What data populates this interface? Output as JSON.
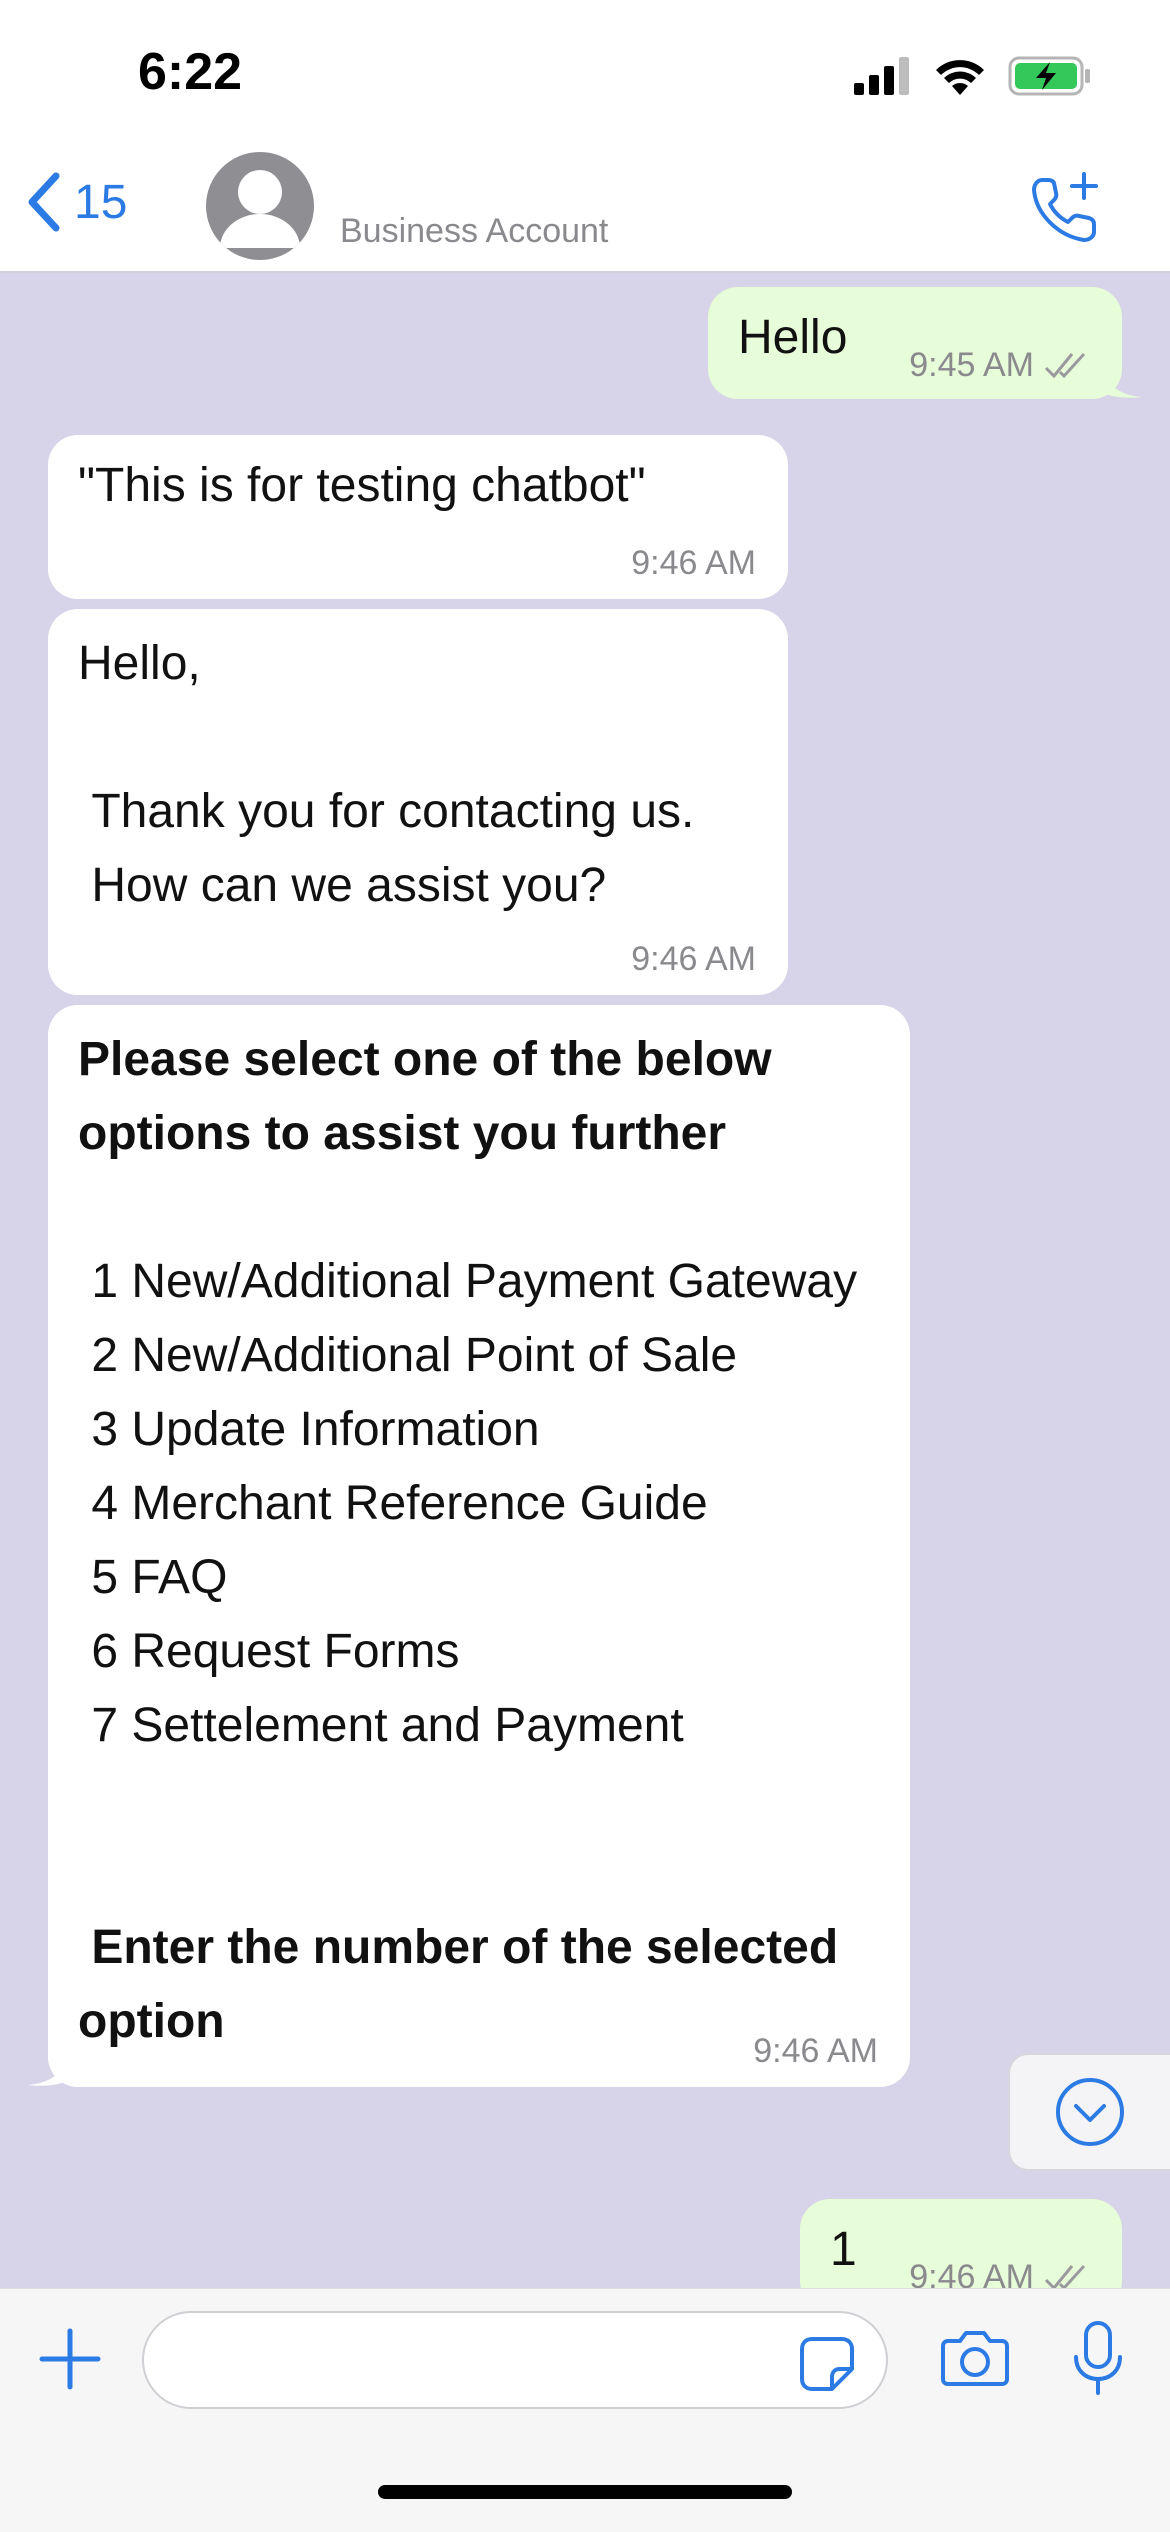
{
  "status_bar": {
    "time": "6:22",
    "icons": [
      "cellular-signal-icon",
      "wifi-icon",
      "battery-charging-icon"
    ]
  },
  "header": {
    "back_count": "15",
    "contact_subtitle": "Business Account",
    "icons": [
      "chevron-left-icon",
      "avatar-placeholder-icon",
      "add-call-icon"
    ]
  },
  "messages": [
    {
      "direction": "outgoing",
      "text": "Hello",
      "time": "9:45 AM",
      "status": "read"
    },
    {
      "direction": "incoming",
      "text": "\"This is for testing chatbot\"",
      "time": "9:46 AM"
    },
    {
      "direction": "incoming",
      "text": "Hello,\n\n Thank you for contacting us.\n How can we assist you?",
      "time": "9:46 AM"
    },
    {
      "direction": "incoming",
      "heading": "Please select one of the below options to assist you further",
      "options": [
        " 1 New/Additional Payment Gateway",
        " 2 New/Additional Point of Sale",
        " 3 Update Information",
        " 4 Merchant Reference Guide",
        " 5 FAQ",
        " 6 Request Forms",
        " 7 Settelement and Payment"
      ],
      "footer": " Enter the number of the selected option",
      "time": "9:46 AM"
    },
    {
      "direction": "outgoing",
      "text": "1",
      "time": "9:46 AM",
      "status": "read"
    }
  ],
  "composer": {
    "icons": [
      "plus-icon",
      "sticker-icon",
      "camera-icon",
      "microphone-icon"
    ]
  },
  "scroll_button": {
    "icon": "chevron-down-circle-icon"
  },
  "colors": {
    "chat_background": "#d7d3e8",
    "incoming_bubble": "#ffffff",
    "outgoing_bubble": "#e7fcd8",
    "accent": "#2c7be5"
  }
}
